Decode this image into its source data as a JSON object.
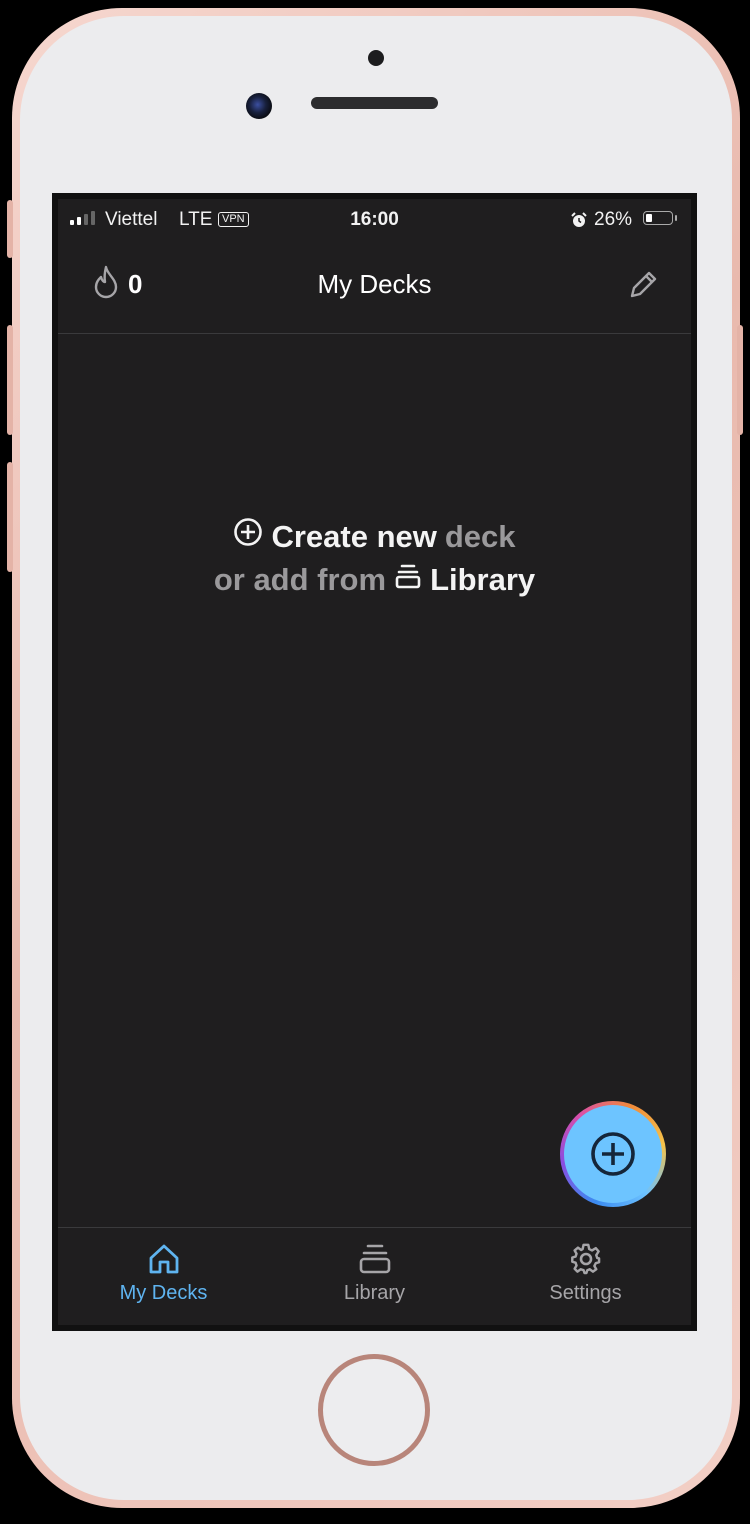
{
  "status_bar": {
    "carrier": "Viettel",
    "network": "LTE",
    "vpn": "VPN",
    "time": "16:00",
    "battery_percent": "26%",
    "battery_level": 0.26,
    "signal_bars": 2,
    "icons": [
      "signal-icon",
      "alarm-icon",
      "battery-icon"
    ]
  },
  "header": {
    "streak_icon": "flame-icon",
    "streak_count": "0",
    "title": "My Decks",
    "edit_icon": "pencil-icon"
  },
  "empty_state": {
    "create_icon": "plus-circle-icon",
    "create_label": "Create new",
    "deck_word": "deck",
    "or_add_from": "or add from",
    "library_icon": "stack-icon",
    "library_label": "Library"
  },
  "fab": {
    "icon": "plus-circle-icon"
  },
  "tab_bar": {
    "items": [
      {
        "label": "My Decks",
        "icon": "home-icon",
        "active": true
      },
      {
        "label": "Library",
        "icon": "stack-icon",
        "active": false
      },
      {
        "label": "Settings",
        "icon": "gear-icon",
        "active": false
      }
    ]
  },
  "colors": {
    "background": "#1f1e1f",
    "accent": "#5fb4f0",
    "fab": "#6dc4ff",
    "muted_text": "#9a999b",
    "phone_frame": "#f3cfc6"
  }
}
